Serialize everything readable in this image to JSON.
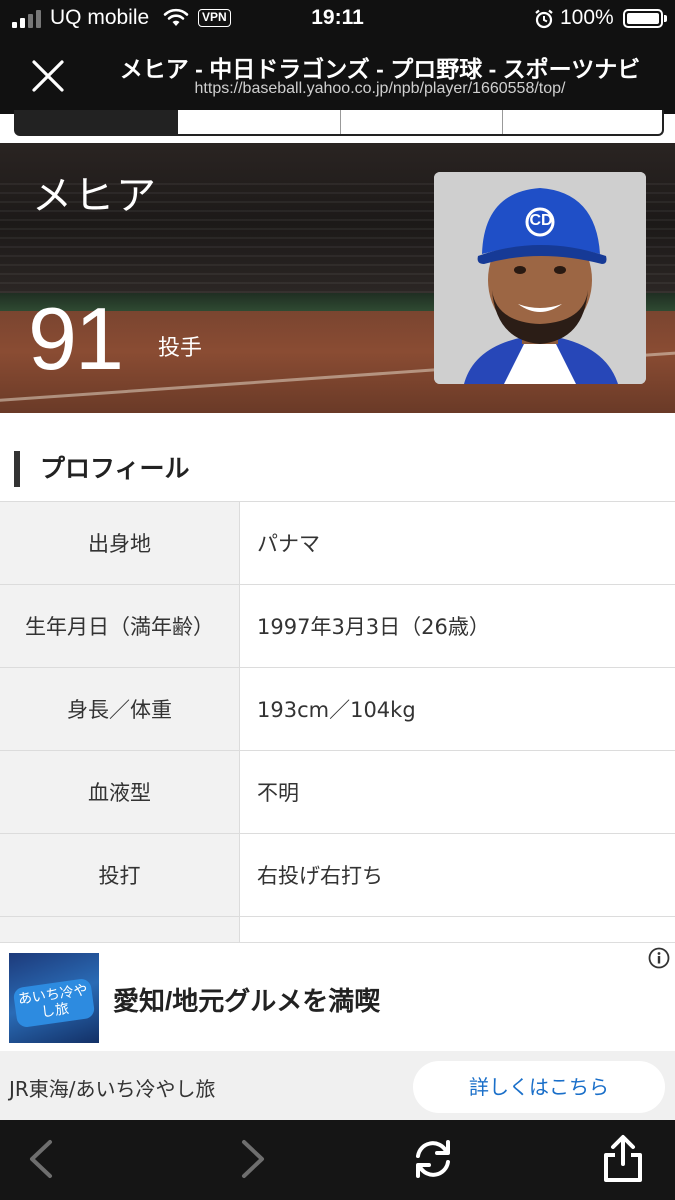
{
  "status_bar": {
    "carrier": "UQ mobile",
    "vpn": "VPN",
    "time": "19:11",
    "battery": "100%"
  },
  "browser": {
    "title": "メヒア - 中日ドラゴンズ - プロ野球 - スポーツナビ",
    "url": "https://baseball.yahoo.co.jp/npb/player/1660558/top/"
  },
  "player": {
    "name": "メヒア",
    "number": "91",
    "position": "投手",
    "cap_logo": "CD"
  },
  "profile": {
    "heading": "プロフィール",
    "rows": [
      {
        "label": "出身地",
        "value": "パナマ"
      },
      {
        "label": "生年月日（満年齢）",
        "value": "1997年3月3日（26歳）"
      },
      {
        "label": "身長／体重",
        "value": "193cm／104kg"
      },
      {
        "label": "血液型",
        "value": "不明"
      },
      {
        "label": "投打",
        "value": "右投げ右打ち"
      }
    ]
  },
  "ad": {
    "thumb_text": "あいち冷やし旅",
    "headline": "愛知/地元グルメを満喫",
    "sponsor": "JR東海/あいち冷やし旅",
    "cta": "詳しくはこちら"
  },
  "icons": {
    "close": "close-icon",
    "back": "chevron-left-icon",
    "forward": "chevron-right-icon",
    "reload": "reload-icon",
    "share": "share-icon",
    "ad_info": "info-icon"
  },
  "colors": {
    "toolbar_bg": "#151515",
    "cta_text": "#1a6fc9",
    "cap_blue": "#1f4fc7"
  }
}
